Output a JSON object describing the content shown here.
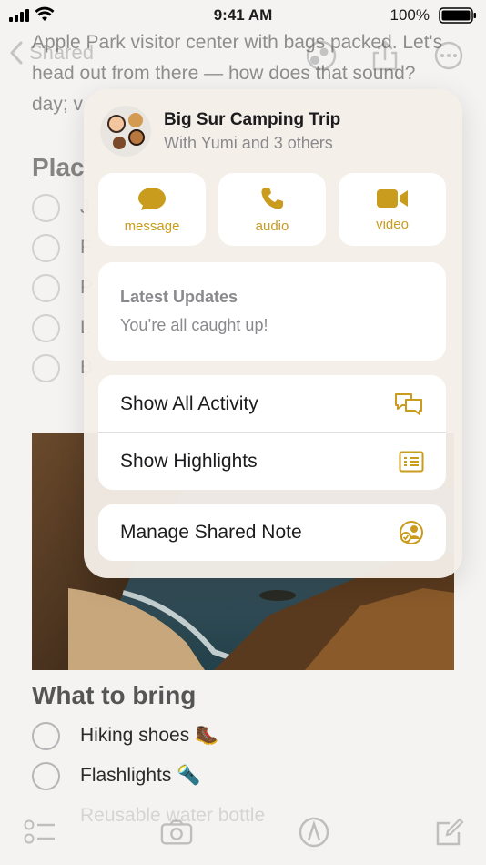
{
  "status": {
    "time": "9:41 AM",
    "battery": "100%"
  },
  "nav": {
    "back_label": "Shared"
  },
  "note": {
    "paragraph": "Apple Park visitor center with bags packed. Let's head out from there — how does that sound? day; v",
    "places_heading": "Plac",
    "places_items": [
      "J",
      "F",
      "P",
      "L",
      "B"
    ]
  },
  "bring": {
    "heading": "What to bring",
    "items": [
      "Hiking shoes 🥾",
      "Flashlights 🔦",
      "Reusable water bottle"
    ]
  },
  "popover": {
    "group_title": "Big Sur Camping Trip",
    "group_subtitle": "With Yumi and 3 others",
    "actions": [
      {
        "label": "message",
        "icon": "message-bubble-icon"
      },
      {
        "label": "audio",
        "icon": "phone-icon"
      },
      {
        "label": "video",
        "icon": "video-camera-icon"
      }
    ],
    "updates_title": "Latest Updates",
    "updates_text": "You’re all caught up!",
    "menu": [
      {
        "label": "Show All Activity",
        "icon": "activity-bubbles-icon"
      },
      {
        "label": "Show Highlights",
        "icon": "highlights-list-icon"
      }
    ],
    "manage_label": "Manage Shared Note",
    "manage_icon": "manage-shared-icon"
  },
  "colors": {
    "accent": "#c99c1e",
    "popover_bg": "#f4eee8"
  }
}
